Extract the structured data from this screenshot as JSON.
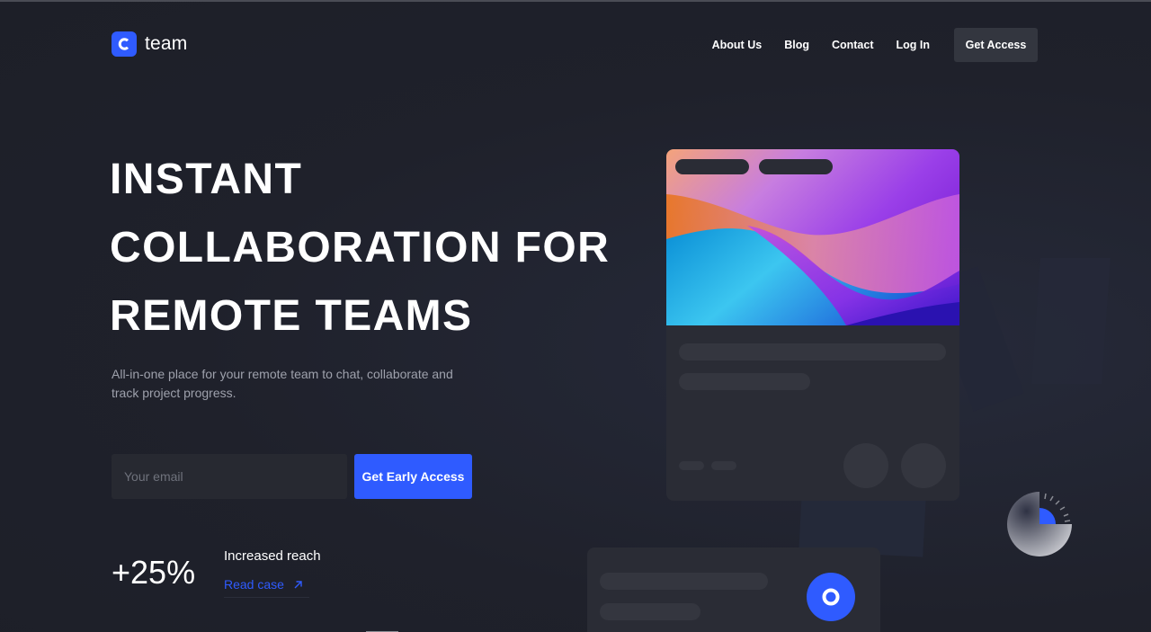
{
  "header": {
    "logo_text": "team",
    "logo_icon": "c-logo-icon",
    "nav": [
      "About Us",
      "Blog",
      "Contact",
      "Log In"
    ],
    "cta_label": "Get Access"
  },
  "hero": {
    "title_lines": [
      "INSTANT",
      "COLLABORATION FOR",
      "REMOTE TEAMS"
    ],
    "subtitle": "All-in-one place for your remote team to chat, collaborate and track project progress.",
    "email_placeholder": "Your email",
    "email_value": "",
    "submit_label": "Get Early Access"
  },
  "stat": {
    "value": "+25%",
    "label": "Increased reach",
    "link_label": "Read case",
    "link_icon": "arrow-up-right-icon"
  },
  "colors": {
    "accent": "#2f5bff",
    "background": "#1f212b",
    "card": "#2a2c35",
    "muted_text": "#9ea1ac"
  }
}
